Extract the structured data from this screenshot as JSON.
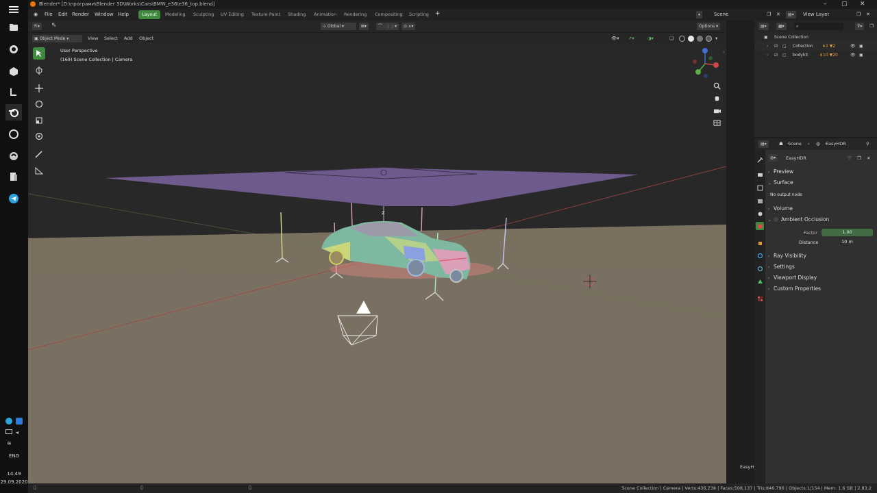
{
  "title": "Blender* [D:\\програми\\Blender 3D\\Works\\Cars\\BMW_e36\\e36_top.blend]",
  "menu": [
    "File",
    "Edit",
    "Render",
    "Window",
    "Help"
  ],
  "workspaces": [
    {
      "label": "Layout",
      "active": true
    },
    {
      "label": "Modeling",
      "active": false
    },
    {
      "label": "Sculpting",
      "active": false
    },
    {
      "label": "UV Editing",
      "active": false
    },
    {
      "label": "Texture Paint",
      "active": false
    },
    {
      "label": "Shading",
      "active": false
    },
    {
      "label": "Animation",
      "active": false
    },
    {
      "label": "Rendering",
      "active": false
    },
    {
      "label": "Compositing",
      "active": false
    },
    {
      "label": "Scripting",
      "active": false
    }
  ],
  "scene_selector": "Scene",
  "view_layer": "View Layer",
  "toolbar": {
    "orientation": "Global",
    "options": "Options"
  },
  "header3": {
    "mode": "Object Mode",
    "items": [
      "View",
      "Select",
      "Add",
      "Object"
    ]
  },
  "viewport": {
    "perspective": "User Perspective",
    "collection_info": "(169) Scene Collection | Camera",
    "axis_z": "Z"
  },
  "outliner": {
    "root": "Scene Collection",
    "items": [
      "Collection",
      "bodykit"
    ]
  },
  "properties": {
    "breadcrumb_scene": "Scene",
    "breadcrumb_world": "EasyHDR",
    "world_name": "EasyHDR",
    "panels": {
      "preview": "Preview",
      "surface": "Surface",
      "no_output": "No output node",
      "volume": "Volume",
      "ao": "Ambient Occlusion",
      "factor_label": "Factor",
      "factor_value": "1.00",
      "distance_label": "Distance",
      "distance_value": "10 m",
      "ray_visibility": "Ray Visibility",
      "settings": "Settings",
      "viewport_display": "Viewport Display",
      "custom_properties": "Custom Properties"
    }
  },
  "easy_tab": "EasyH",
  "status": "Scene Collection | Camera | Verts:436,238 | Faces:508,137 | Tris:846,796 | Objects:1/154 | Mem: 1.6 GB | 2.83.2",
  "taskbar": {
    "lang": "ENG",
    "time": "14:49",
    "date": "29.09.2020"
  },
  "colors": {
    "accent_green": "#3f8a3f",
    "floor": "#7a7061",
    "light_plane": "#6e5a8c"
  }
}
